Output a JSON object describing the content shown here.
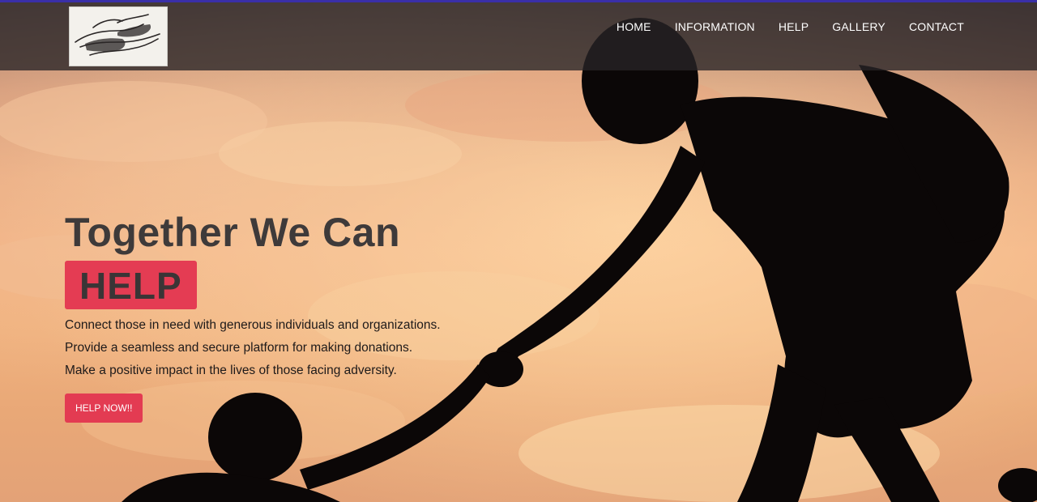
{
  "header": {
    "logo_icon": "helping-hands-logo-icon",
    "nav": [
      {
        "label": "HOME"
      },
      {
        "label": "INFORMATION"
      },
      {
        "label": "HELP"
      },
      {
        "label": "GALLERY"
      },
      {
        "label": "CONTACT"
      }
    ]
  },
  "hero": {
    "title": "Together We Can",
    "highlight": "HELP",
    "lines": [
      "Connect those in need with generous individuals and organizations.",
      "Provide a seamless and secure platform for making donations.",
      "Make a positive impact in the lives of those facing adversity."
    ],
    "cta_label": "HELP NOW!!"
  },
  "colors": {
    "accent_bar": "#3a2fa8",
    "highlight": "#e43c53",
    "button": "#e33b52",
    "header_bg": "#282426"
  }
}
